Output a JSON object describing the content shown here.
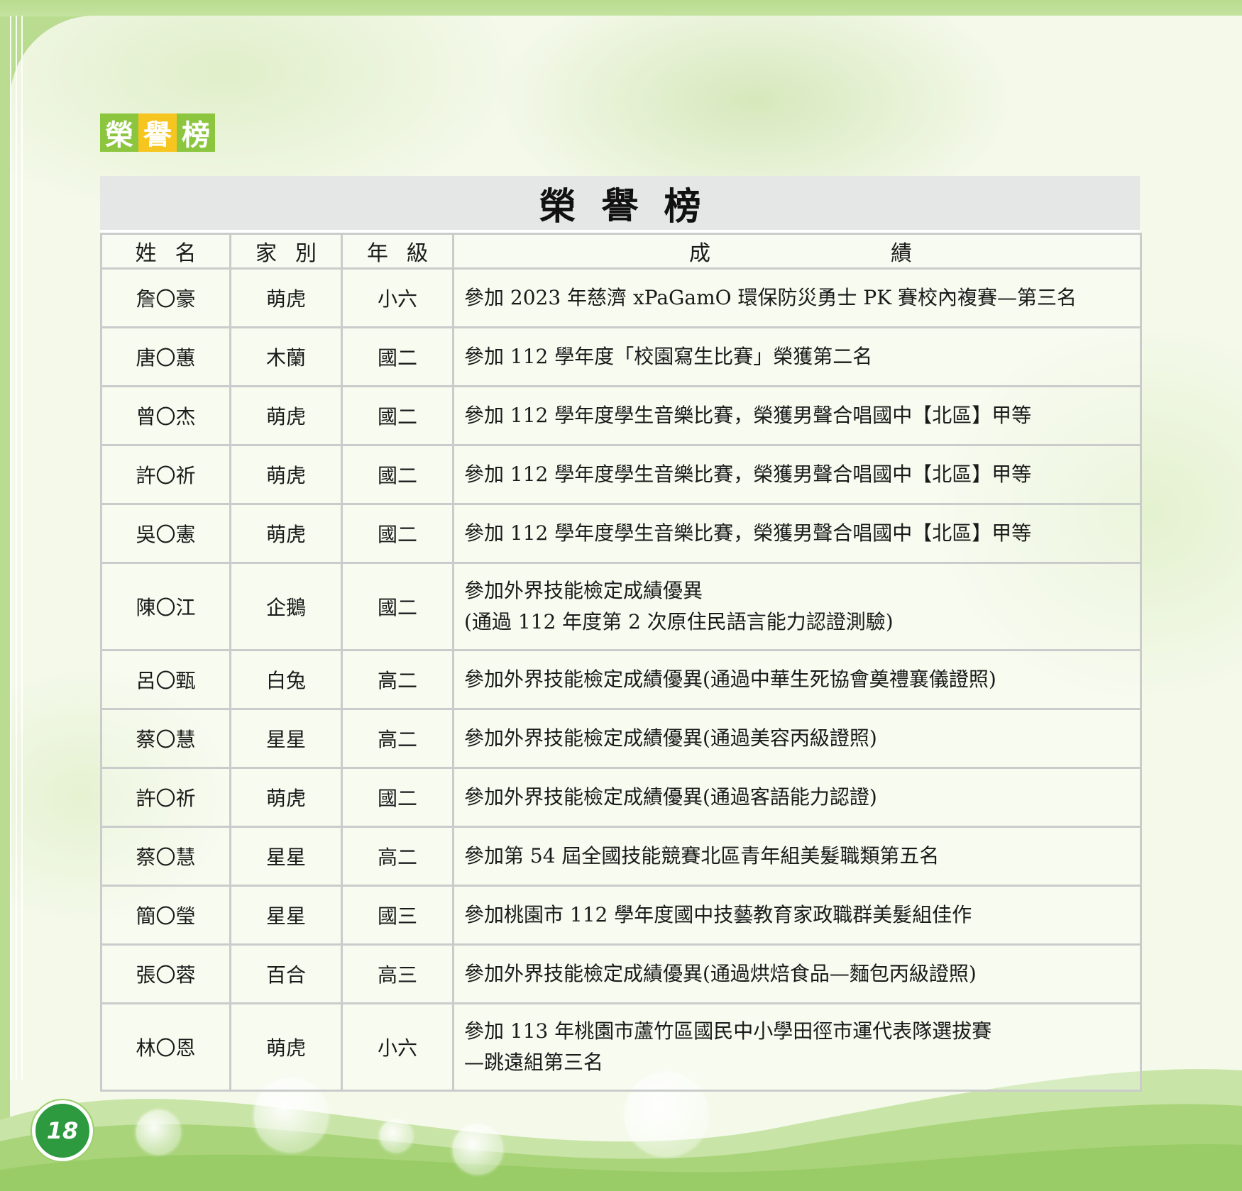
{
  "section_label": [
    "榮",
    "譽",
    "榜"
  ],
  "table_title": "榮譽榜",
  "headers": {
    "name": "姓名",
    "house": "家別",
    "grade": "年級",
    "result_left": "成",
    "result_right": "績"
  },
  "rows": [
    {
      "name": "詹〇豪",
      "house": "萌虎",
      "grade": "小六",
      "result": [
        "參加 2023 年慈濟 xPaGamO 環保防災勇士 PK 賽校內複賽—第三名"
      ]
    },
    {
      "name": "唐〇蕙",
      "house": "木蘭",
      "grade": "國二",
      "result": [
        "參加 112 學年度「校園寫生比賽」榮獲第二名"
      ]
    },
    {
      "name": "曾〇杰",
      "house": "萌虎",
      "grade": "國二",
      "result": [
        "參加 112 學年度學生音樂比賽，榮獲男聲合唱國中【北區】甲等"
      ]
    },
    {
      "name": "許〇祈",
      "house": "萌虎",
      "grade": "國二",
      "result": [
        "參加 112 學年度學生音樂比賽，榮獲男聲合唱國中【北區】甲等"
      ]
    },
    {
      "name": "吳〇憲",
      "house": "萌虎",
      "grade": "國二",
      "result": [
        "參加 112 學年度學生音樂比賽，榮獲男聲合唱國中【北區】甲等"
      ]
    },
    {
      "name": "陳〇江",
      "house": "企鵝",
      "grade": "國二",
      "result": [
        "參加外界技能檢定成績優異",
        "(通過 112 年度第 2 次原住民語言能力認證測驗)"
      ]
    },
    {
      "name": "呂〇甄",
      "house": "白兔",
      "grade": "高二",
      "result": [
        "參加外界技能檢定成績優異(通過中華生死協會奠禮襄儀證照)"
      ]
    },
    {
      "name": "蔡〇慧",
      "house": "星星",
      "grade": "高二",
      "result": [
        "參加外界技能檢定成績優異(通過美容丙級證照)"
      ]
    },
    {
      "name": "許〇祈",
      "house": "萌虎",
      "grade": "國二",
      "result": [
        "參加外界技能檢定成績優異(通過客語能力認證)"
      ]
    },
    {
      "name": "蔡〇慧",
      "house": "星星",
      "grade": "高二",
      "result": [
        "參加第 54 屆全國技能競賽北區青年組美髮職類第五名"
      ]
    },
    {
      "name": "簡〇瑩",
      "house": "星星",
      "grade": "國三",
      "result": [
        "參加桃園市 112 學年度國中技藝教育家政職群美髮組佳作"
      ]
    },
    {
      "name": "張〇蓉",
      "house": "百合",
      "grade": "高三",
      "result": [
        "參加外界技能檢定成績優異(通過烘焙食品—麵包丙級證照)"
      ]
    },
    {
      "name": "林〇恩",
      "house": "萌虎",
      "grade": "小六",
      "result": [
        "參加 113 年桃園市蘆竹區國民中小學田徑市運代表隊選拔賽",
        "—跳遠組第三名"
      ]
    }
  ],
  "page_number": "18",
  "colors": {
    "accent_green": "#8cc63f",
    "accent_yellow": "#f7c520",
    "page_badge": "#2e9a3f",
    "title_bar": "#e4e7e6"
  }
}
